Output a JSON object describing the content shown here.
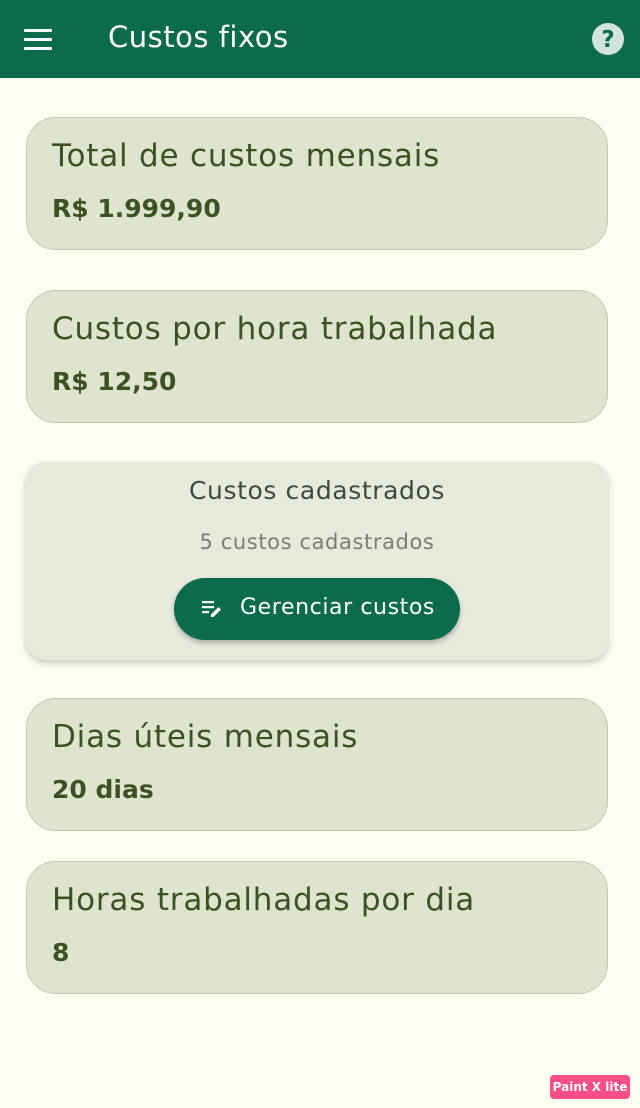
{
  "appbar": {
    "title": "Custos fixos",
    "menu_icon": "menu-icon",
    "help_icon": "help-circle-icon",
    "background": "#0b6b4c"
  },
  "cards": {
    "total": {
      "label": "Total de custos mensais",
      "value": "R$ 1.999,90"
    },
    "per_hour": {
      "label": "Custos por hora trabalhada",
      "value": "R$ 12,50"
    },
    "work_days": {
      "label": "Dias úteis mensais",
      "value": "20 dias"
    },
    "hours_per_day": {
      "label": "Horas trabalhadas por dia",
      "value": "8"
    }
  },
  "registered": {
    "title": "Custos cadastrados",
    "count_text": "5 custos cadastrados",
    "button_label": "Gerenciar custos",
    "button_icon": "edit-note-icon"
  },
  "watermark": "Paint X lite",
  "colors": {
    "primary": "#0b6b4c",
    "background": "#fdfef1",
    "card": "#dfe4cf",
    "text": "#3b5323",
    "watermark": "#ff4f86"
  }
}
